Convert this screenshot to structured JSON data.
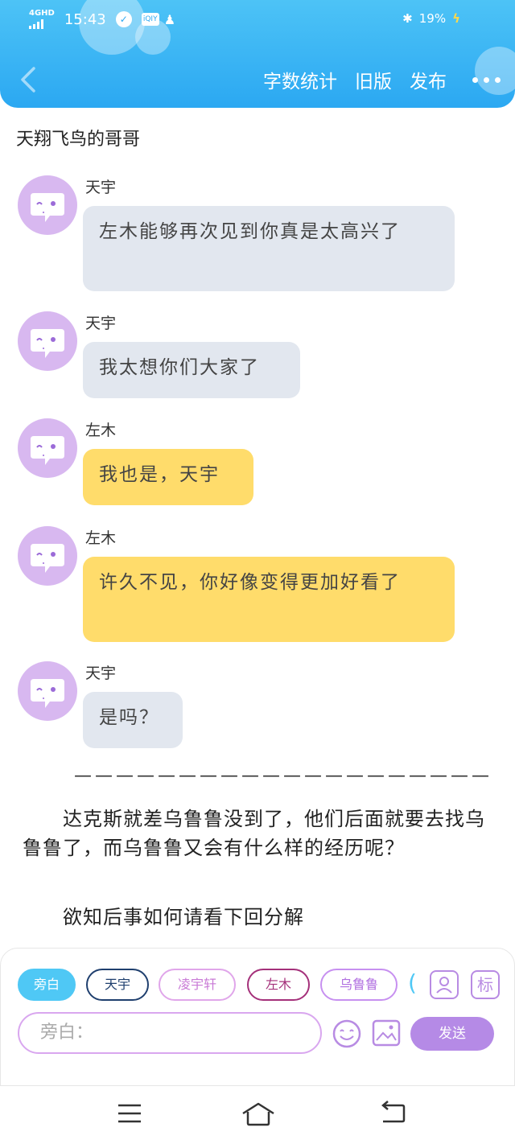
{
  "status_bar": {
    "network": "4GHD",
    "time": "15:43",
    "battery": "19%"
  },
  "header": {
    "actions": [
      "字数统计",
      "旧版",
      "发布"
    ],
    "more_icon": "more-dots-icon",
    "back_icon": "chevron-left-icon",
    "gradient_colors": [
      "#4dc3f6",
      "#2ba8f2"
    ]
  },
  "document": {
    "title": "天翔飞鸟的哥哥"
  },
  "messages": [
    {
      "speaker": "天宇",
      "text": "左木能够再次见到你真是太高兴了",
      "color": "gray"
    },
    {
      "speaker": "天宇",
      "text": "我太想你们大家了",
      "color": "gray"
    },
    {
      "speaker": "左木",
      "text": "我也是，天宇",
      "color": "yellow"
    },
    {
      "speaker": "左木",
      "text": "许久不见，你好像变得更加好看了",
      "color": "yellow"
    },
    {
      "speaker": "天宇",
      "text": "是吗？",
      "color": "gray"
    }
  ],
  "divider": "————————————————————",
  "narration": [
    "　　达克斯就差乌鲁鲁没到了，他们后面就要去找乌鲁鲁了，而乌鲁鲁又会有什么样的经历呢？",
    "　　欲知后事如何请看下回分解"
  ],
  "input_panel": {
    "roles": [
      "旁白",
      "天宇",
      "凌宇轩",
      "左木",
      "乌鲁鲁"
    ],
    "active_role": "旁白",
    "placeholder": "旁白：",
    "send_label": "发送",
    "tag_label": "标",
    "accent_color": "#b58ae6"
  },
  "system_nav": {
    "icons": [
      "menu-icon",
      "home-icon",
      "back-icon"
    ]
  }
}
